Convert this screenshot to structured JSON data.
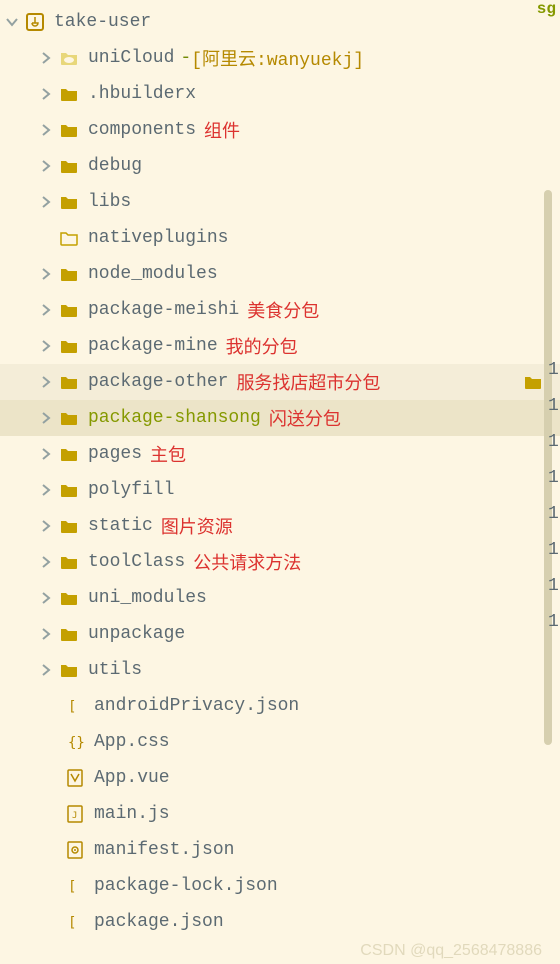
{
  "corner": "sg",
  "root": {
    "label": "take-user"
  },
  "items": [
    {
      "label": "uniCloud",
      "suffix_dash": " - ",
      "suffix_brackets": "[阿里云:wanyuekj]",
      "icon": "folder-cloud",
      "expandable": true
    },
    {
      "label": ".hbuilderx",
      "icon": "folder",
      "expandable": true
    },
    {
      "label": "components",
      "icon": "folder",
      "annotation": "组件",
      "expandable": true
    },
    {
      "label": "debug",
      "icon": "folder",
      "expandable": true
    },
    {
      "label": "libs",
      "icon": "folder",
      "expandable": true
    },
    {
      "label": "nativeplugins",
      "icon": "folder-outline",
      "expandable": false
    },
    {
      "label": "node_modules",
      "icon": "folder",
      "expandable": true
    },
    {
      "label": "package-meishi",
      "icon": "folder",
      "annotation": "美食分包",
      "expandable": true
    },
    {
      "label": "package-mine",
      "icon": "folder",
      "annotation": "我的分包",
      "expandable": true
    },
    {
      "label": "package-other",
      "icon": "folder",
      "annotation": "服务找店超市分包",
      "expandable": true,
      "hl": 1,
      "trail_folder": true
    },
    {
      "label": "package-shansong",
      "icon": "folder",
      "annotation": "闪送分包",
      "expandable": true,
      "hl": 2,
      "green": true
    },
    {
      "label": "pages",
      "icon": "folder",
      "annotation": "主包",
      "expandable": true
    },
    {
      "label": "polyfill",
      "icon": "folder",
      "expandable": true
    },
    {
      "label": "static",
      "icon": "folder",
      "annotation": "图片资源",
      "expandable": true
    },
    {
      "label": "toolClass",
      "icon": "folder",
      "annotation": "公共请求方法",
      "expandable": true
    },
    {
      "label": "uni_modules",
      "icon": "folder",
      "expandable": true
    },
    {
      "label": "unpackage",
      "icon": "folder",
      "expandable": true
    },
    {
      "label": "utils",
      "icon": "folder",
      "expandable": true
    },
    {
      "label": "androidPrivacy.json",
      "icon": "file-json",
      "file": true
    },
    {
      "label": "App.css",
      "icon": "file-css",
      "file": true
    },
    {
      "label": "App.vue",
      "icon": "file-vue",
      "file": true
    },
    {
      "label": "main.js",
      "icon": "file-js",
      "file": true
    },
    {
      "label": "manifest.json",
      "icon": "file-gear",
      "file": true
    },
    {
      "label": "package-lock.json",
      "icon": "file-json",
      "file": true
    },
    {
      "label": "package.json",
      "icon": "file-json",
      "file": true
    }
  ],
  "gutter": [
    "1",
    "1",
    "1",
    "1",
    "1",
    "1",
    "1",
    "1"
  ],
  "watermark": "CSDN @qq_2568478886"
}
